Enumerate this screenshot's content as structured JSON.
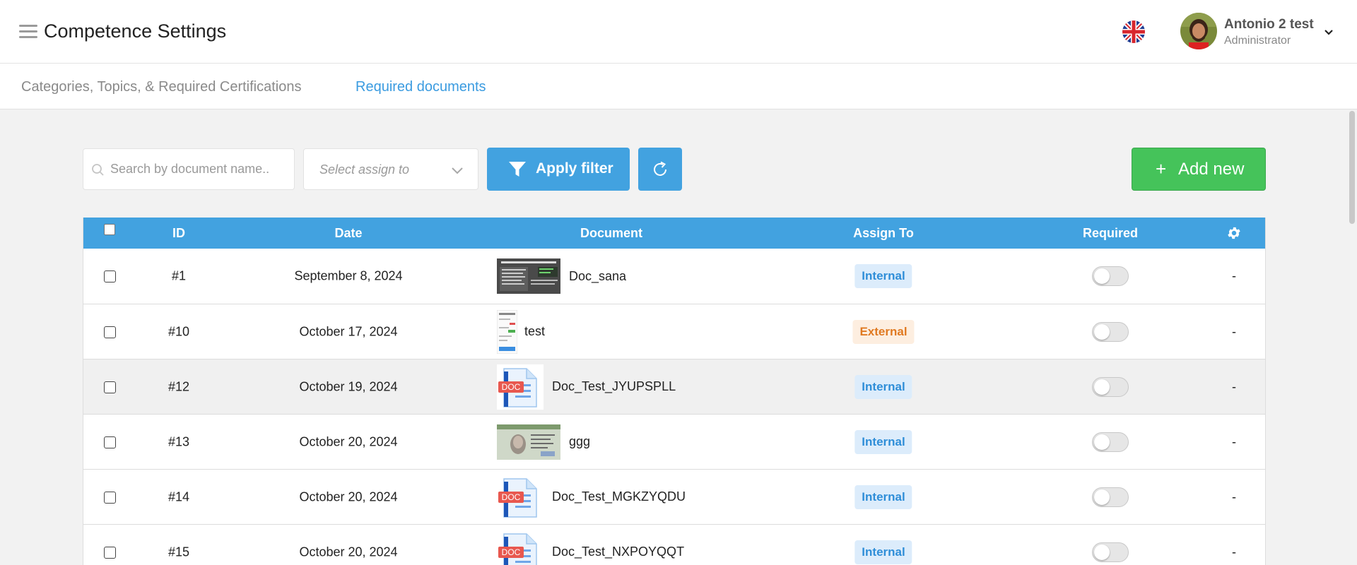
{
  "header": {
    "title": "Competence Settings",
    "menu_icon": "hamburger-menu-icon",
    "language_flag": "uk-flag-icon",
    "user": {
      "name": "Antonio 2 test",
      "role": "Administrator"
    }
  },
  "tabs": [
    {
      "label": "Categories, Topics, & Required Certifications",
      "active": false
    },
    {
      "label": "Required documents",
      "active": true
    }
  ],
  "toolbar": {
    "search_placeholder": "Search by document name..",
    "assign_placeholder": "Select assign to",
    "apply_label": "Apply filter",
    "add_label": "Add new"
  },
  "table": {
    "columns": [
      "ID",
      "Date",
      "Document",
      "Assign To",
      "Required"
    ],
    "rows": [
      {
        "id": "#1",
        "date": "September 8, 2024",
        "document": "Doc_sana",
        "thumb": "screenshot",
        "assign": "Internal",
        "required": false,
        "action": "-"
      },
      {
        "id": "#10",
        "date": "October 17, 2024",
        "document": "test",
        "thumb": "phone",
        "assign": "External",
        "required": false,
        "action": "-"
      },
      {
        "id": "#12",
        "date": "October 19, 2024",
        "document": "Doc_Test_JYUPSPLL",
        "thumb": "doc",
        "assign": "Internal",
        "required": false,
        "action": "-"
      },
      {
        "id": "#13",
        "date": "October 20, 2024",
        "document": "ggg",
        "thumb": "idcard",
        "assign": "Internal",
        "required": false,
        "action": "-"
      },
      {
        "id": "#14",
        "date": "October 20, 2024",
        "document": "Doc_Test_MGKZYQDU",
        "thumb": "doc",
        "assign": "Internal",
        "required": false,
        "action": "-"
      },
      {
        "id": "#15",
        "date": "October 20, 2024",
        "document": "Doc_Test_NXPOYQQT",
        "thumb": "doc",
        "assign": "Internal",
        "required": false,
        "action": "-"
      }
    ]
  },
  "colors": {
    "accent": "#42a2e0",
    "add_button": "#45c35a",
    "internal_text": "#2f8ed8",
    "external_text": "#e07a22"
  }
}
